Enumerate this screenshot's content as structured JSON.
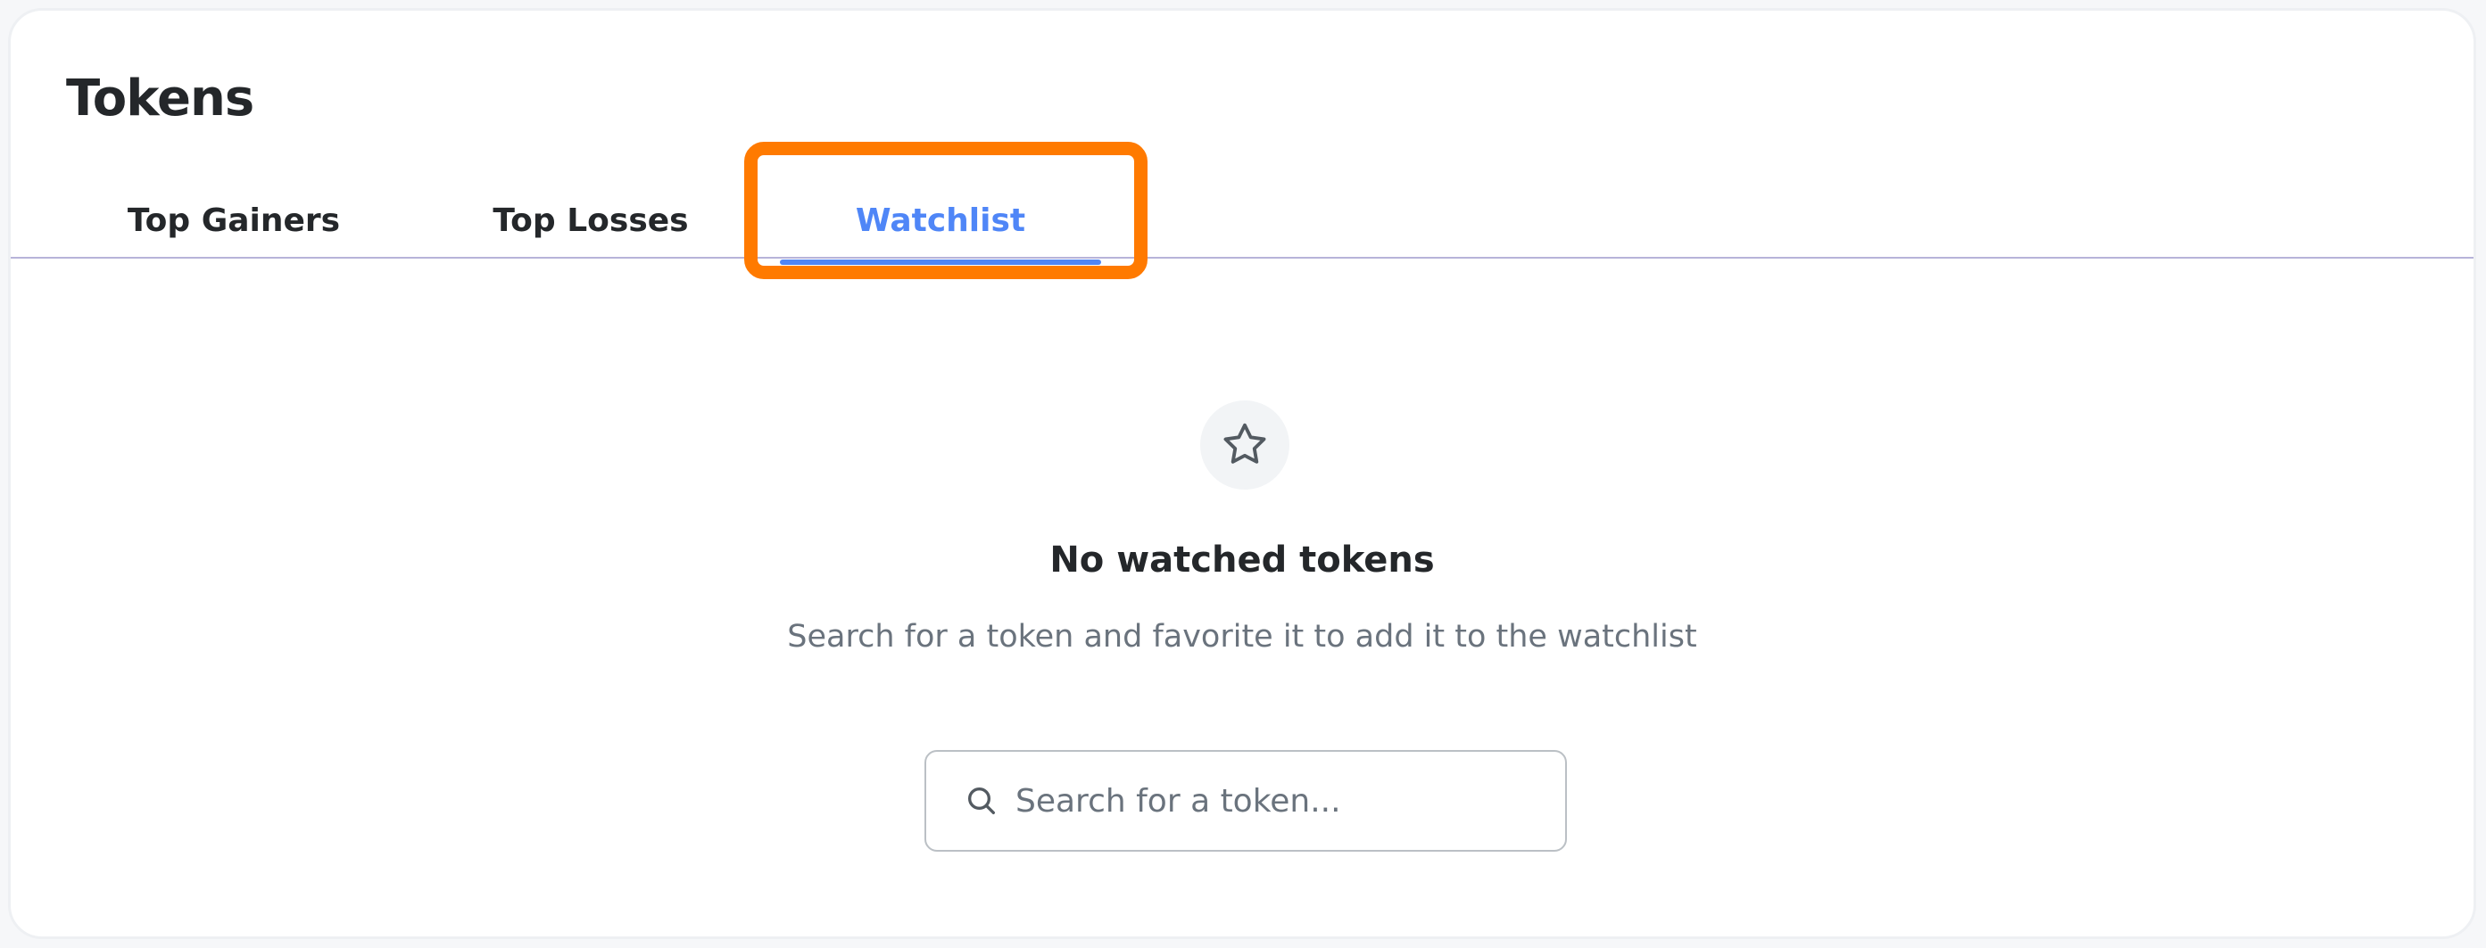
{
  "header": {
    "title": "Tokens"
  },
  "tabs": [
    {
      "label": "Top Gainers",
      "active": false
    },
    {
      "label": "Top Losses",
      "active": false
    },
    {
      "label": "Watchlist",
      "active": true
    }
  ],
  "empty_state": {
    "icon": "star-icon",
    "title": "No watched tokens",
    "description": "Search for a token and favorite it to add it to the watchlist"
  },
  "search": {
    "icon": "search-icon",
    "value": "",
    "placeholder": "Search for a token..."
  },
  "colors": {
    "accent": "#4f86f7",
    "highlight": "#ff7a00",
    "text_primary": "#24272a",
    "text_muted": "#6a737d",
    "divider": "#b7b3d9"
  }
}
